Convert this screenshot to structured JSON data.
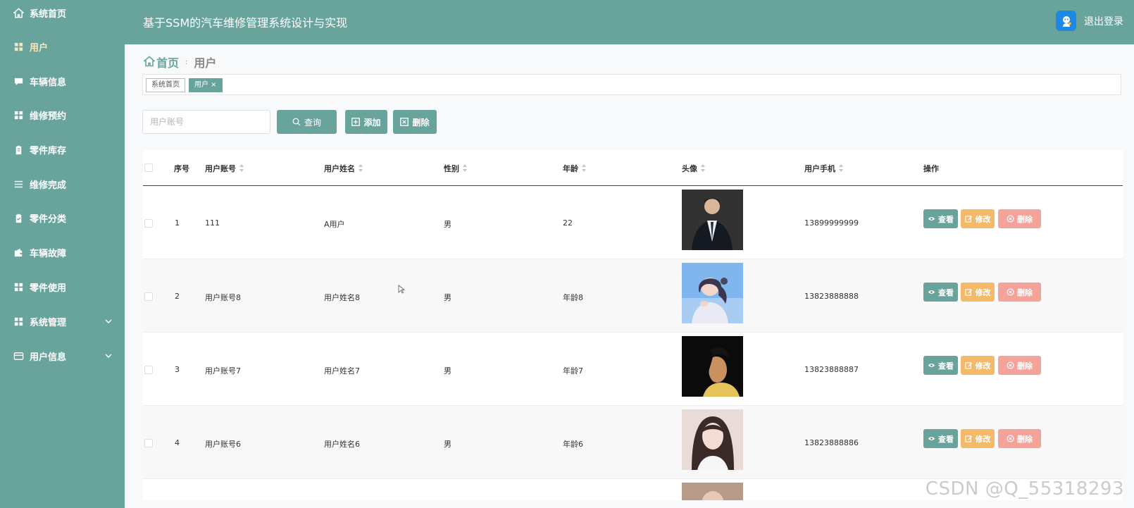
{
  "app": {
    "title": "基于SSM的汽车维修管理系统设计与实现",
    "logout": "退出登录"
  },
  "sidebar": {
    "items": [
      {
        "label": "系统首页",
        "icon": "home-icon"
      },
      {
        "label": "用户",
        "icon": "grid-icon",
        "active": true
      },
      {
        "label": "车辆信息",
        "icon": "chat-icon"
      },
      {
        "label": "维修预约",
        "icon": "grid-icon"
      },
      {
        "label": "零件库存",
        "icon": "clipboard-icon"
      },
      {
        "label": "维修完成",
        "icon": "list-icon"
      },
      {
        "label": "零件分类",
        "icon": "clipboard-check-icon"
      },
      {
        "label": "车辆故障",
        "icon": "wallet-icon"
      },
      {
        "label": "零件使用",
        "icon": "grid-icon"
      },
      {
        "label": "系统管理",
        "icon": "grid-icon",
        "expandable": true
      },
      {
        "label": "用户信息",
        "icon": "card-icon",
        "expandable": true
      }
    ]
  },
  "breadcrumb": {
    "home": "首页",
    "separator": "ː",
    "current": "用户"
  },
  "tags": [
    {
      "label": "系统首页"
    },
    {
      "label": "用户 ×",
      "active": true
    }
  ],
  "search": {
    "placeholder": "用户账号",
    "value": ""
  },
  "buttons": {
    "search": "查询",
    "add": "添加",
    "delete": "删除"
  },
  "table": {
    "headers": {
      "index": "序号",
      "account": "用户账号",
      "name": "用户姓名",
      "gender": "性别",
      "age": "年龄",
      "avatar": "头像",
      "phone": "用户手机",
      "actions": "操作"
    },
    "rows": [
      {
        "index": "1",
        "account": "111",
        "name": "A用户",
        "gender": "男",
        "age": "22",
        "phone": "13899999999",
        "photo": "man-in-suit"
      },
      {
        "index": "2",
        "account": "用户账号8",
        "name": "用户姓名8",
        "gender": "男",
        "age": "年龄8",
        "phone": "13823888888",
        "photo": "girl-blue-sky"
      },
      {
        "index": "3",
        "account": "用户账号7",
        "name": "用户姓名7",
        "gender": "男",
        "age": "年龄7",
        "phone": "13823888887",
        "photo": "boy-dark"
      },
      {
        "index": "4",
        "account": "用户账号6",
        "name": "用户姓名6",
        "gender": "男",
        "age": "年龄6",
        "phone": "13823888886",
        "photo": "girl-long-hair"
      }
    ],
    "row_actions": {
      "view": "查看",
      "edit": "修改",
      "delete": "删除"
    }
  },
  "watermark": "CSDN @Q_55318293",
  "colors": {
    "primary": "#69a49c",
    "edit": "#f4b969",
    "delete": "#f5a39a",
    "active_menu": "#f7e6b8"
  }
}
